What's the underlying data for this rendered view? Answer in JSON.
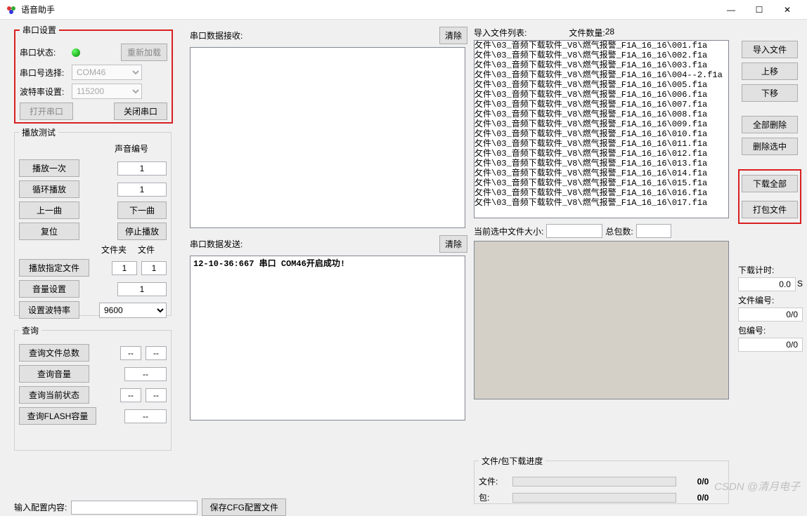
{
  "title": "语音助手",
  "window_buttons": {
    "min": "—",
    "max": "☐",
    "close": "✕"
  },
  "serial": {
    "legend": "串口设置",
    "status_label": "串口状态:",
    "reload_btn": "重新加载",
    "port_label": "串口号选择:",
    "port_value": "COM46",
    "baud_label": "波特率设置:",
    "baud_value": "115200",
    "open_btn": "打开串口",
    "close_btn": "关闭串口"
  },
  "play": {
    "legend": "播放测试",
    "sound_no_label": "声音编号",
    "play_once": "播放一次",
    "sound_no_1": "1",
    "loop_play": "循环播放",
    "sound_no_2": "1",
    "prev": "上一曲",
    "next": "下一曲",
    "reset": "复位",
    "stop": "停止播放",
    "folder_hdr": "文件夹",
    "file_hdr": "文件",
    "play_specified": "播放指定文件",
    "folder_val": "1",
    "file_val": "1",
    "vol_set": "音量设置",
    "vol_val": "1",
    "set_baud": "设置波特率",
    "baud_sel": "9600"
  },
  "query": {
    "legend": "查询",
    "total_files": "查询文件总数",
    "total_files_val1": "--",
    "total_files_val2": "--",
    "volume": "查询音量",
    "volume_val": "--",
    "cur_state": "查询当前状态",
    "cur_state_val1": "--",
    "cur_state_val2": "--",
    "flash": "查询FLASH容量",
    "flash_val": "--"
  },
  "recv": {
    "label": "串口数据接收:",
    "clear": "清除"
  },
  "send": {
    "label": "串口数据发送:",
    "clear": "清除",
    "log": "12-10-36:667 串口 COM46开启成功!"
  },
  "filelist": {
    "label": "导入文件列表:",
    "count_label": "文件数量:",
    "count": "28",
    "items": [
      "攵件\\03_音频下载软件_V8\\燃气报警_F1A_16_16\\001.f1a",
      "攵件\\03_音频下载软件_V8\\燃气报警_F1A_16_16\\002.f1a",
      "攵件\\03_音频下载软件_V8\\燃气报警_F1A_16_16\\003.f1a",
      "攵件\\03_音频下载软件_V8\\燃气报警_F1A_16_16\\004--2.f1a",
      "攵件\\03_音频下载软件_V8\\燃气报警_F1A_16_16\\005.f1a",
      "攵件\\03_音频下载软件_V8\\燃气报警_F1A_16_16\\006.f1a",
      "攵件\\03_音频下载软件_V8\\燃气报警_F1A_16_16\\007.f1a",
      "攵件\\03_音频下载软件_V8\\燃气报警_F1A_16_16\\008.f1a",
      "攵件\\03_音频下载软件_V8\\燃气报警_F1A_16_16\\009.f1a",
      "攵件\\03_音频下载软件_V8\\燃气报警_F1A_16_16\\010.f1a",
      "攵件\\03_音频下载软件_V8\\燃气报警_F1A_16_16\\011.f1a",
      "攵件\\03_音频下载软件_V8\\燃气报警_F1A_16_16\\012.f1a",
      "攵件\\03_音频下载软件_V8\\燃气报警_F1A_16_16\\013.f1a",
      "攵件\\03_音频下载软件_V8\\燃气报警_F1A_16_16\\014.f1a",
      "攵件\\03_音频下载软件_V8\\燃气报警_F1A_16_16\\015.f1a",
      "攵件\\03_音频下载软件_V8\\燃气报警_F1A_16_16\\016.f1a",
      "攵件\\03_音频下载软件_V8\\燃气报警_F1A_16_16\\017.f1a"
    ]
  },
  "curfile": {
    "size_label": "当前选中文件大小:",
    "size_val": "",
    "total_pkt_label": "总包数:",
    "total_pkt_val": ""
  },
  "far": {
    "import": "导入文件",
    "up": "上移",
    "down": "下移",
    "del_all": "全部删除",
    "del_sel": "删除选中",
    "dl_all": "下载全部",
    "pack": "打包文件"
  },
  "stats": {
    "dl_time_label": "下载计时:",
    "dl_time_val": "0.0",
    "dl_time_unit": "S",
    "file_no_label": "文件编号:",
    "file_no_val": "0/0",
    "pkt_no_label": "包编号:",
    "pkt_no_val": "0/0"
  },
  "progress": {
    "legend": "文件/包下载进度",
    "file_label": "文件:",
    "file_val": "0/0",
    "pkt_label": "包:",
    "pkt_val": "0/0"
  },
  "bottom": {
    "cfg_label": "输入配置内容:",
    "save_btn": "保存CFG配置文件"
  },
  "watermark": "CSDN @清月电子"
}
